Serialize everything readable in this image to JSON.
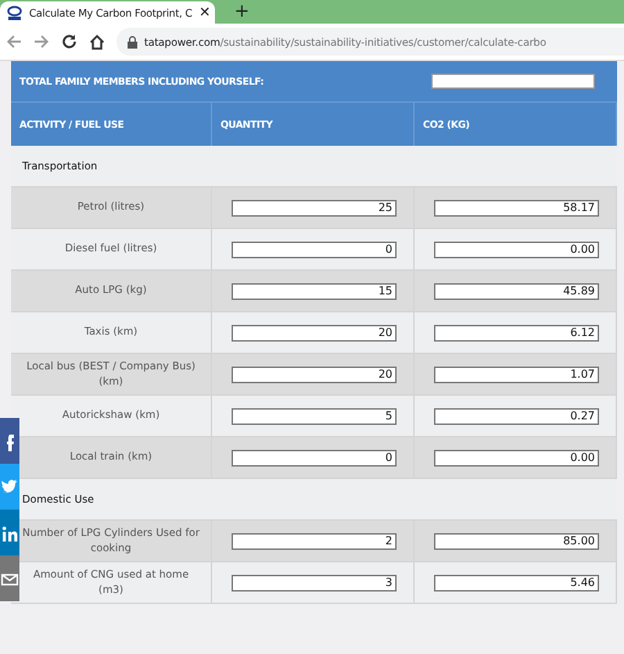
{
  "browser": {
    "tab_title": "Calculate My Carbon Footprint, C",
    "close_tab": "✕",
    "new_tab": "+",
    "url_host": "tatapower.com",
    "url_path": "/sustainability/sustainability-initiatives/customer/calculate-carbo"
  },
  "family_members": {
    "label": "TOTAL FAMILY MEMBERS INCLUDING YOURSELF:"
  },
  "columns": [
    "ACTIVITY / FUEL USE",
    "QUANTITY",
    "CO2 (KG)"
  ],
  "sections": [
    {
      "title": "Transportation",
      "rows": [
        {
          "activity": "Petrol (litres)",
          "quantity": "25",
          "co2": "58.17"
        },
        {
          "activity": "Diesel fuel (litres)",
          "quantity": "0",
          "co2": "0.00"
        },
        {
          "activity": "Auto LPG (kg)",
          "quantity": "15",
          "co2": "45.89"
        },
        {
          "activity": "Taxis (km)",
          "quantity": "20",
          "co2": "6.12"
        },
        {
          "activity": "Local bus (BEST / Company Bus) (km)",
          "quantity": "20",
          "co2": "1.07"
        },
        {
          "activity": "Autorickshaw (km)",
          "quantity": "5",
          "co2": "0.27"
        },
        {
          "activity": "Local train (km)",
          "quantity": "0",
          "co2": "0.00"
        }
      ]
    },
    {
      "title": "Domestic Use",
      "rows": [
        {
          "activity": "Number of LPG Cylinders Used for cooking",
          "quantity": "2",
          "co2": "85.00"
        },
        {
          "activity": "Amount of CNG used at home (m3)",
          "quantity": "3",
          "co2": "5.46"
        }
      ]
    }
  ],
  "share_buttons": [
    {
      "kind": "facebook"
    },
    {
      "kind": "twitter"
    },
    {
      "kind": "linkedin"
    },
    {
      "kind": "email"
    }
  ]
}
